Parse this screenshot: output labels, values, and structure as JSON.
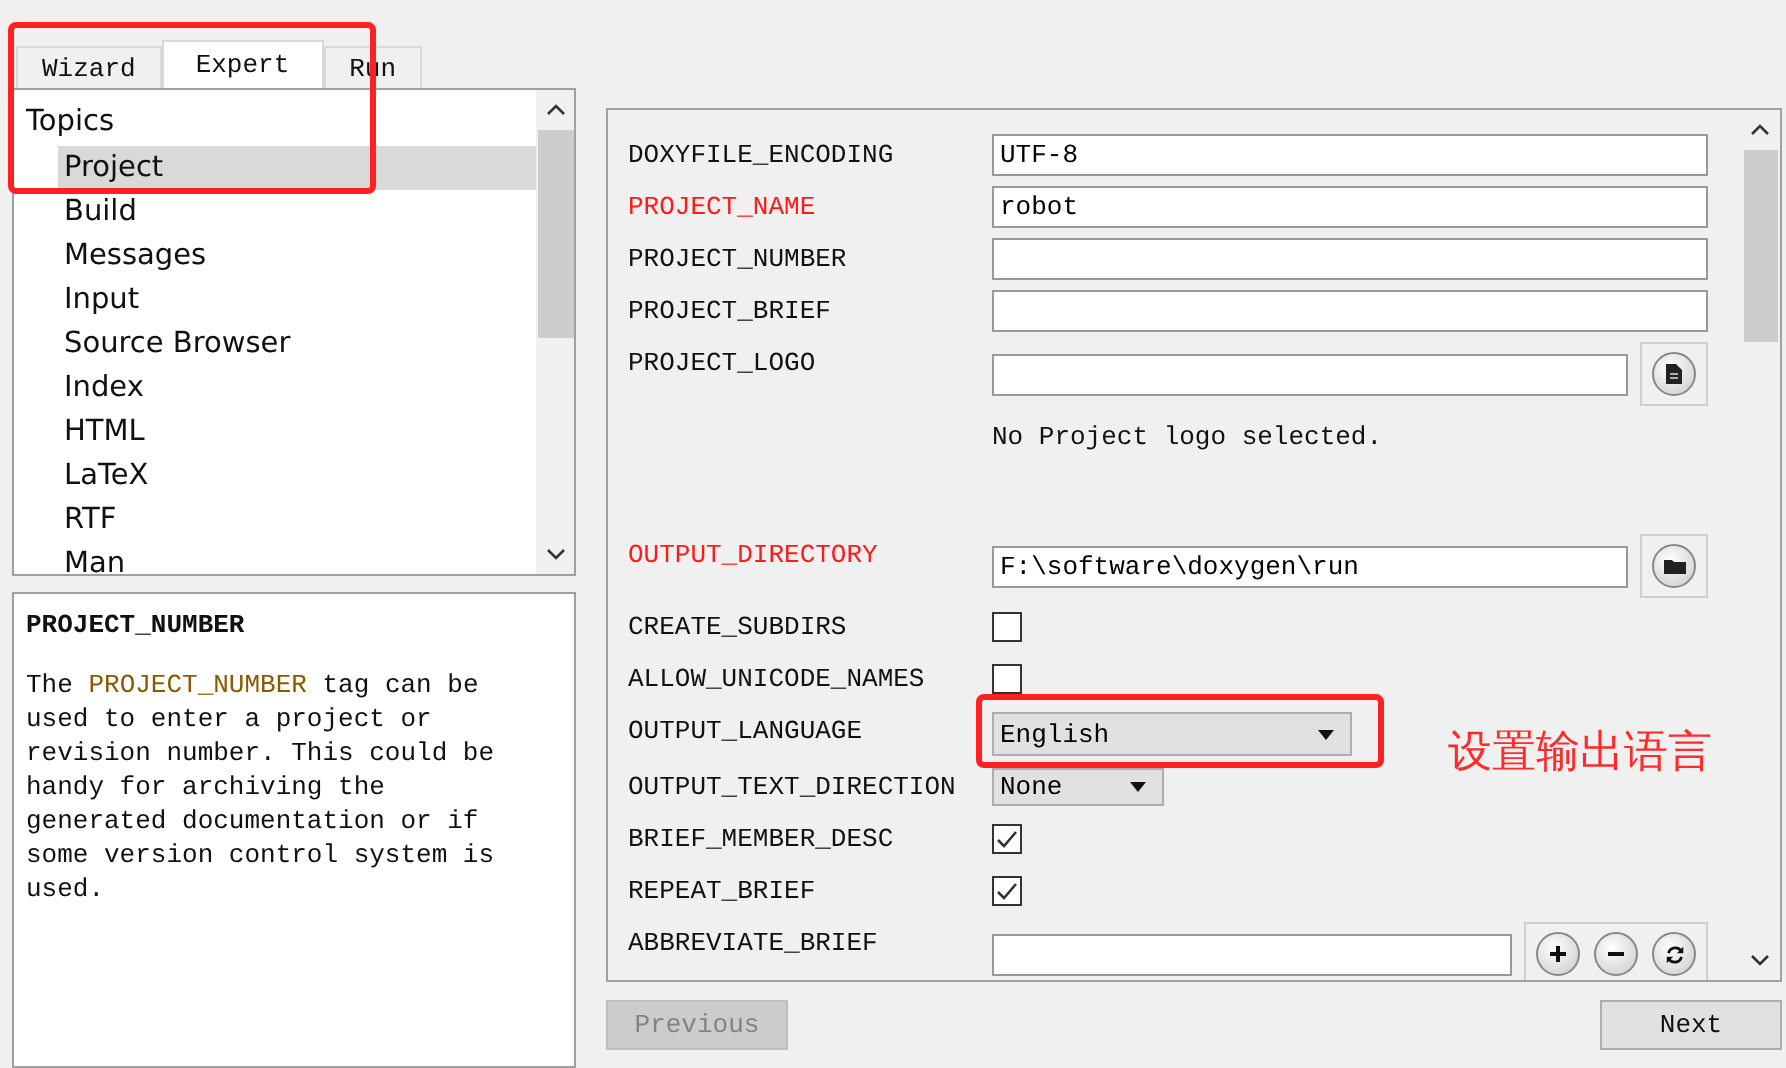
{
  "tabs": [
    {
      "label": "Wizard",
      "selected": false
    },
    {
      "label": "Expert",
      "selected": true
    },
    {
      "label": "Run",
      "selected": false
    }
  ],
  "topics": {
    "heading": "Topics",
    "items": [
      {
        "label": "Project",
        "selected": true
      },
      {
        "label": "Build",
        "selected": false
      },
      {
        "label": "Messages",
        "selected": false
      },
      {
        "label": "Input",
        "selected": false
      },
      {
        "label": "Source Browser",
        "selected": false
      },
      {
        "label": "Index",
        "selected": false
      },
      {
        "label": "HTML",
        "selected": false
      },
      {
        "label": "LaTeX",
        "selected": false
      },
      {
        "label": "RTF",
        "selected": false
      },
      {
        "label": "Man",
        "selected": false
      }
    ]
  },
  "help": {
    "title": "PROJECT_NUMBER",
    "text_before": "The ",
    "tag": "PROJECT_NUMBER",
    "text_after": " tag can be used to enter a project or revision number. This could be handy for archiving the generated documentation or if some version control system is used."
  },
  "settings": [
    {
      "kind": "text",
      "label": "DOXYFILE_ENCODING",
      "highlighted": false,
      "value": "UTF-8"
    },
    {
      "kind": "text",
      "label": "PROJECT_NAME",
      "highlighted": true,
      "value": "robot"
    },
    {
      "kind": "text",
      "label": "PROJECT_NUMBER",
      "highlighted": false
    },
    {
      "kind": "text",
      "label": "PROJECT_BRIEF",
      "highlighted": false
    },
    {
      "kind": "file",
      "label": "PROJECT_LOGO",
      "highlighted": false,
      "note": "No Project logo selected."
    },
    {
      "kind": "folder",
      "label": "OUTPUT_DIRECTORY",
      "highlighted": true,
      "value": "F:\\software\\doxygen\\run"
    },
    {
      "kind": "checkbox",
      "label": "CREATE_SUBDIRS",
      "highlighted": false,
      "checked": false
    },
    {
      "kind": "checkbox",
      "label": "ALLOW_UNICODE_NAMES",
      "highlighted": false,
      "checked": false
    },
    {
      "kind": "combo",
      "label": "OUTPUT_LANGUAGE",
      "highlighted": false,
      "value": "English"
    },
    {
      "kind": "combo",
      "label": "OUTPUT_TEXT_DIRECTION",
      "highlighted": false,
      "value": "None"
    },
    {
      "kind": "checkbox",
      "label": "BRIEF_MEMBER_DESC",
      "highlighted": false,
      "checked": true
    },
    {
      "kind": "checkbox",
      "label": "REPEAT_BRIEF",
      "highlighted": false,
      "checked": true
    },
    {
      "kind": "list",
      "label": "ABBREVIATE_BRIEF",
      "highlighted": false
    }
  ],
  "annotation_note": "设置输出语言",
  "buttons": [
    {
      "label": "Previous",
      "disabled": true
    },
    {
      "label": "Next",
      "disabled": false
    }
  ]
}
